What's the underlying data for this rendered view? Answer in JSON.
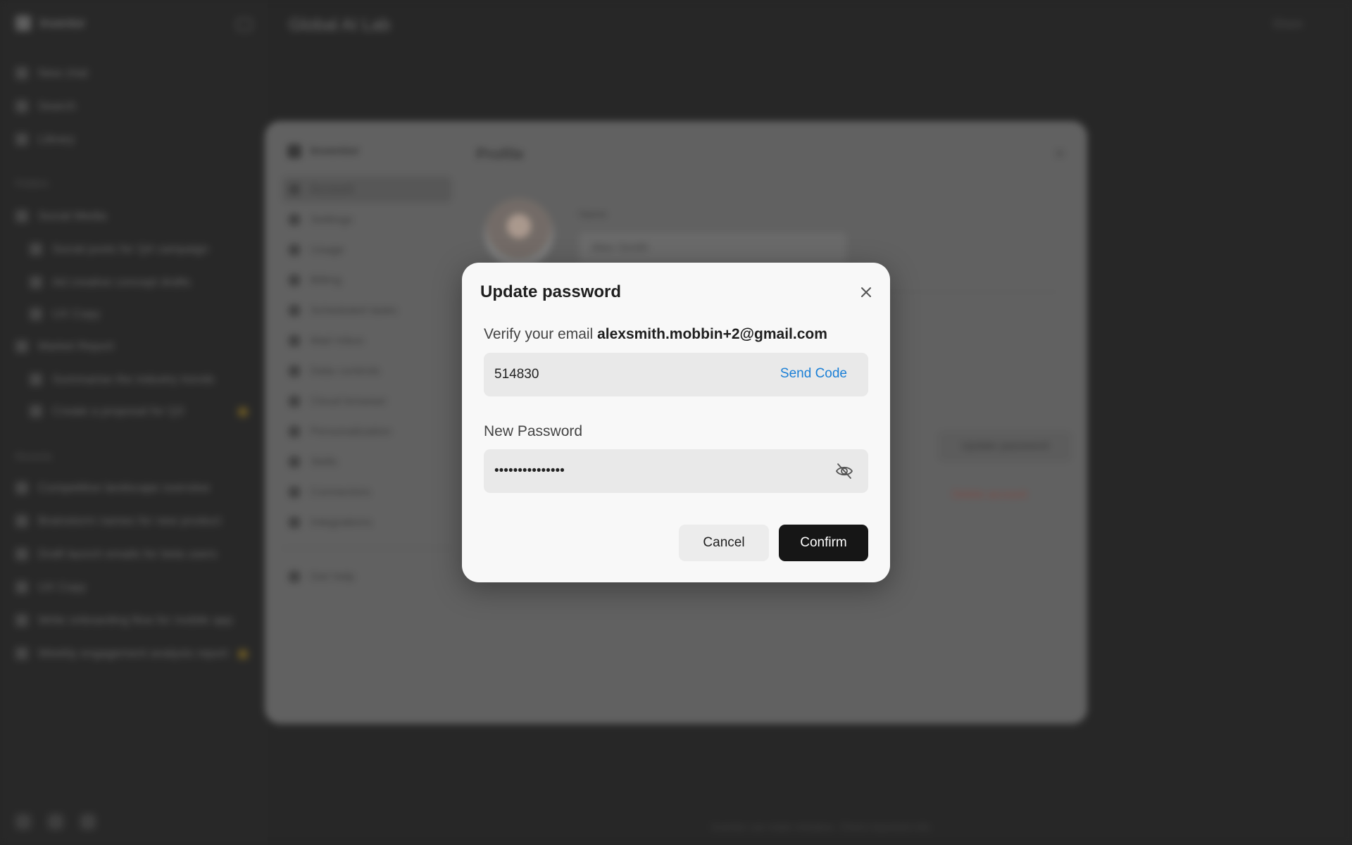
{
  "background": {
    "app_name": "Inventor",
    "page_title": "Global AI Lab",
    "share_label": "Share",
    "sidebar": {
      "top_items": [
        "New chat",
        "Search",
        "Library"
      ],
      "section_1_label": "Folders",
      "section_1_items": [
        {
          "label": "Social Media",
          "sub": false
        },
        {
          "label": "Social posts for Q4 campaign",
          "sub": true
        },
        {
          "label": "Ad creative concept drafts",
          "sub": true
        },
        {
          "label": "UX Copy",
          "sub": true
        },
        {
          "label": "Market Report",
          "sub": false
        },
        {
          "label": "Summarise the industry trends",
          "sub": true
        },
        {
          "label": "Create a proposal for Q3",
          "sub": true
        }
      ],
      "section_2_label": "Recents",
      "section_2_items": [
        "Competitive landscape overview",
        "Brainstorm names for new product",
        "Draft launch emails for beta users",
        "UX Copy",
        "Write onboarding flow for mobile app",
        "Weekly engagement analysis report"
      ]
    },
    "footer_note": "Inventor can make mistakes. Check important info."
  },
  "settings": {
    "brand": "Inventor",
    "title": "Profile",
    "nav": [
      "Account",
      "Settings",
      "Usage",
      "Billing",
      "Scheduled tasks",
      "Mail Inbox",
      "Data controls",
      "Cloud browser",
      "Personalization",
      "Skills",
      "Connectors",
      "Integrations"
    ],
    "help": "Get help",
    "name_label": "Name",
    "name_value": "Alex Smith",
    "update_password_label": "Update password",
    "delete_account_label": "Delete account"
  },
  "dialog": {
    "title": "Update password",
    "verify_prefix": "Verify your email",
    "email": "alexsmith.mobbin+2@gmail.com",
    "code_value": "514830",
    "send_code_label": "Send Code",
    "new_password_label": "New Password",
    "password_value": "•••••••••••••••",
    "cancel_label": "Cancel",
    "confirm_label": "Confirm",
    "icons": {
      "close": "close-icon",
      "visibility": "eye-off-icon"
    }
  }
}
